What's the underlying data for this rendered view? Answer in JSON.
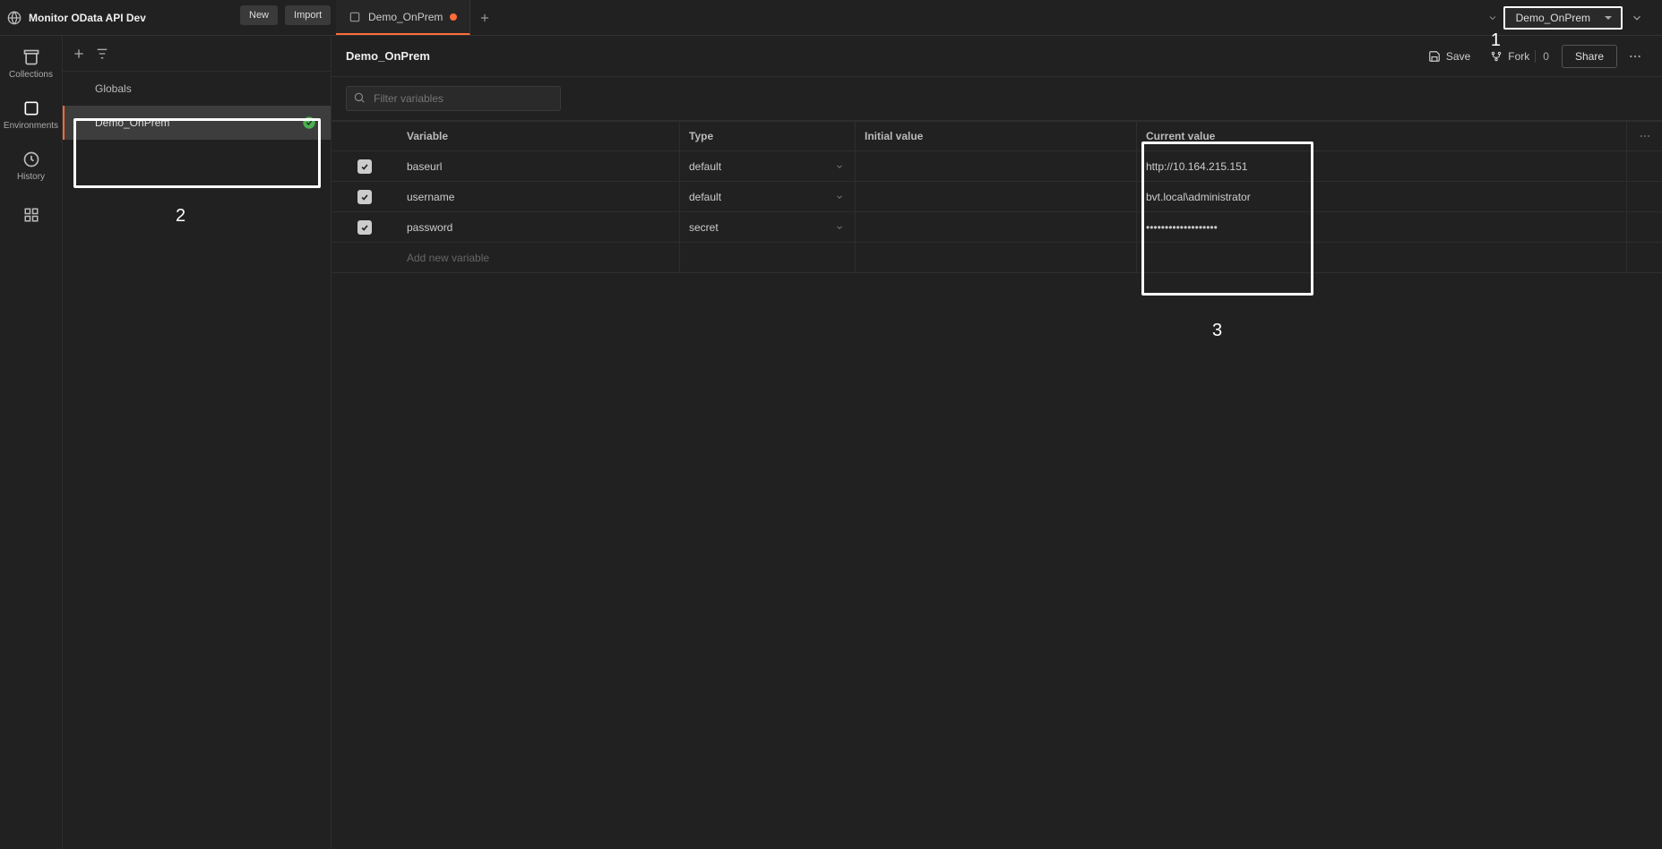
{
  "workspace": {
    "name": "Monitor OData API Dev"
  },
  "topButtons": {
    "new": "New",
    "import": "Import"
  },
  "tab": {
    "name": "Demo_OnPrem"
  },
  "envSelector": {
    "value": "Demo_OnPrem"
  },
  "rail": {
    "collections": "Collections",
    "environments": "Environments",
    "history": "History"
  },
  "sidebar": {
    "globals": "Globals",
    "env": "Demo_OnPrem"
  },
  "callouts": {
    "one": "1",
    "two": "2",
    "three": "3"
  },
  "page": {
    "title": "Demo_OnPrem",
    "save": "Save",
    "fork": "Fork",
    "forkCount": "0",
    "share": "Share",
    "filterPlaceholder": "Filter variables"
  },
  "table": {
    "headers": {
      "variable": "Variable",
      "type": "Type",
      "initial": "Initial value",
      "current": "Current value"
    },
    "rows": [
      {
        "checked": true,
        "variable": "baseurl",
        "type": "default",
        "initial": "",
        "current": "http://10.164.215.151"
      },
      {
        "checked": true,
        "variable": "username",
        "type": "default",
        "initial": "",
        "current": "bvt.local\\administrator"
      },
      {
        "checked": true,
        "variable": "password",
        "type": "secret",
        "initial": "",
        "current": "•••••••••••••••••••"
      }
    ],
    "addPlaceholder": "Add new variable"
  }
}
